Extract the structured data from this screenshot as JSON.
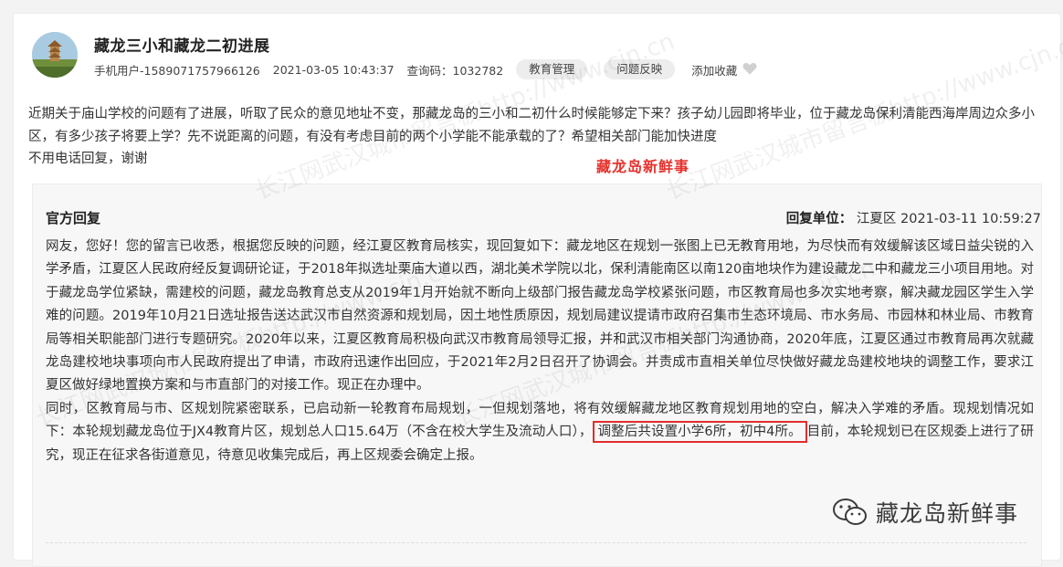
{
  "post": {
    "title": "藏龙三小和藏龙二初进展",
    "user": "手机用户-1589071757966126",
    "datetime": "2021-03-05 10:43:37",
    "query_label": "查询码：1032782",
    "tags": [
      "教育管理",
      "问题反映"
    ],
    "favorite_label": "添加收藏",
    "question": [
      "近期关于庙山学校的问题有了进展，听取了民众的意见地址不变，那藏龙岛的三小和二初什么时候能够定下来？孩子幼儿园即将毕业，位于藏龙岛保利清能西海岸周边众多小区，有多少孩子将要上学？先不说距离的问题，有没有考虑目前的两个小学能不能承载的了？希望相关部门能加快进度",
      "不用电话回复，谢谢"
    ],
    "overlay_label": "藏龙岛新鲜事"
  },
  "reply": {
    "heading": "官方回复",
    "unit_label": "回复单位：",
    "unit": "江夏区",
    "datetime": "2021-03-11 10:59:27",
    "para1": "网友，您好！您的留言已收悉，根据您反映的问题，经江夏区教育局核实，现回复如下：藏龙地区在规划一张图上已无教育用地，为尽快而有效缓解该区域日益尖锐的入学矛盾，江夏区人民政府经反复调研论证，于2018年拟选址栗庙大道以西，湖北美术学院以北，保利清能南区以南120亩地块作为建设藏龙二中和藏龙三小项目用地。对于藏龙岛学位紧缺，需建校的问题，藏龙岛教育总支从2019年1月开始就不断向上级部门报告藏龙岛学校紧张问题，市区教育局也多次实地考察，解决藏龙园区学生入学难的问题。2019年10月21日选址报告送达武汉市自然资源和规划局，因土地性质原因，规划局建议提请市政府召集市生态环境局、市水务局、市园林和林业局、市教育局等相关职能部门进行专题研究。2020年以来，江夏区教育局积极向武汉市教育局领导汇报，并和武汉市相关部门沟通协商，2020年底，江夏区通过市教育局再次就藏龙岛建校地块事项向市人民政府提出了申请，市政府迅速作出回应，于2021年2月2日召开了协调会。并责成市直相关单位尽快做好藏龙岛建校地块的调整工作，要求江夏区做好绿地置换方案和与市直部门的对接工作。现正在办理中。",
    "para2_a": "同时，区教育局与市、区规划院紧密联系，已启动新一轮教育布局规划，一但规划落地，将有效缓解藏龙地区教育规划用地的空白，解决入学难的矛盾。现规划情况如下：本轮规划藏龙岛位于JX4教育片区，规划总人口15.64万（不含在校大学生及流动人口），",
    "para2_highlight": "调整后共设置小学6所，初中4所。",
    "para2_b": "目前，本轮规划已在区规委上进行了研究，现正在征求各街道意见，待意见收集完成后，再上区规委会确定上报。"
  },
  "watermark": {
    "text": "长江网武汉城市留言板http://www.cjn.cn",
    "wechat_label": "藏龙岛新鲜事"
  },
  "colors": {
    "accent_red": "#e5322d",
    "box_red": "#e32d2d",
    "tag_bg": "#ededed"
  }
}
